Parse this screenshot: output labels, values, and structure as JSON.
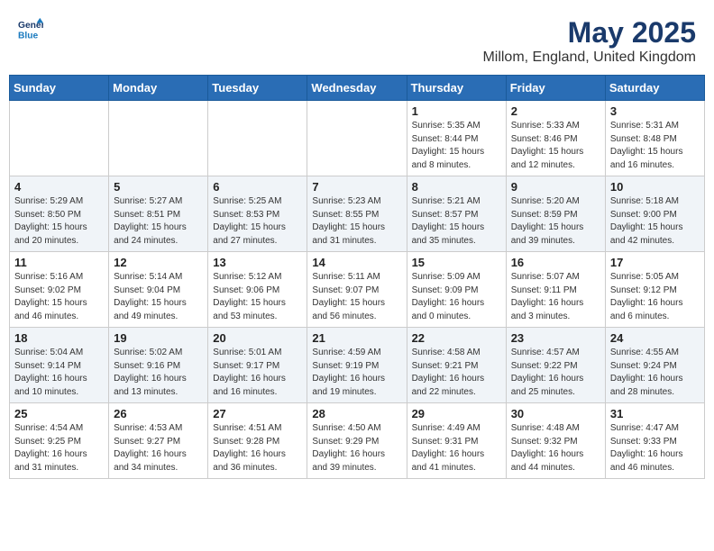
{
  "header": {
    "logo_line1": "General",
    "logo_line2": "Blue",
    "title": "May 2025",
    "subtitle": "Millom, England, United Kingdom"
  },
  "weekdays": [
    "Sunday",
    "Monday",
    "Tuesday",
    "Wednesday",
    "Thursday",
    "Friday",
    "Saturday"
  ],
  "weeks": [
    [
      {
        "day": "",
        "info": ""
      },
      {
        "day": "",
        "info": ""
      },
      {
        "day": "",
        "info": ""
      },
      {
        "day": "",
        "info": ""
      },
      {
        "day": "1",
        "info": "Sunrise: 5:35 AM\nSunset: 8:44 PM\nDaylight: 15 hours\nand 8 minutes."
      },
      {
        "day": "2",
        "info": "Sunrise: 5:33 AM\nSunset: 8:46 PM\nDaylight: 15 hours\nand 12 minutes."
      },
      {
        "day": "3",
        "info": "Sunrise: 5:31 AM\nSunset: 8:48 PM\nDaylight: 15 hours\nand 16 minutes."
      }
    ],
    [
      {
        "day": "4",
        "info": "Sunrise: 5:29 AM\nSunset: 8:50 PM\nDaylight: 15 hours\nand 20 minutes."
      },
      {
        "day": "5",
        "info": "Sunrise: 5:27 AM\nSunset: 8:51 PM\nDaylight: 15 hours\nand 24 minutes."
      },
      {
        "day": "6",
        "info": "Sunrise: 5:25 AM\nSunset: 8:53 PM\nDaylight: 15 hours\nand 27 minutes."
      },
      {
        "day": "7",
        "info": "Sunrise: 5:23 AM\nSunset: 8:55 PM\nDaylight: 15 hours\nand 31 minutes."
      },
      {
        "day": "8",
        "info": "Sunrise: 5:21 AM\nSunset: 8:57 PM\nDaylight: 15 hours\nand 35 minutes."
      },
      {
        "day": "9",
        "info": "Sunrise: 5:20 AM\nSunset: 8:59 PM\nDaylight: 15 hours\nand 39 minutes."
      },
      {
        "day": "10",
        "info": "Sunrise: 5:18 AM\nSunset: 9:00 PM\nDaylight: 15 hours\nand 42 minutes."
      }
    ],
    [
      {
        "day": "11",
        "info": "Sunrise: 5:16 AM\nSunset: 9:02 PM\nDaylight: 15 hours\nand 46 minutes."
      },
      {
        "day": "12",
        "info": "Sunrise: 5:14 AM\nSunset: 9:04 PM\nDaylight: 15 hours\nand 49 minutes."
      },
      {
        "day": "13",
        "info": "Sunrise: 5:12 AM\nSunset: 9:06 PM\nDaylight: 15 hours\nand 53 minutes."
      },
      {
        "day": "14",
        "info": "Sunrise: 5:11 AM\nSunset: 9:07 PM\nDaylight: 15 hours\nand 56 minutes."
      },
      {
        "day": "15",
        "info": "Sunrise: 5:09 AM\nSunset: 9:09 PM\nDaylight: 16 hours\nand 0 minutes."
      },
      {
        "day": "16",
        "info": "Sunrise: 5:07 AM\nSunset: 9:11 PM\nDaylight: 16 hours\nand 3 minutes."
      },
      {
        "day": "17",
        "info": "Sunrise: 5:05 AM\nSunset: 9:12 PM\nDaylight: 16 hours\nand 6 minutes."
      }
    ],
    [
      {
        "day": "18",
        "info": "Sunrise: 5:04 AM\nSunset: 9:14 PM\nDaylight: 16 hours\nand 10 minutes."
      },
      {
        "day": "19",
        "info": "Sunrise: 5:02 AM\nSunset: 9:16 PM\nDaylight: 16 hours\nand 13 minutes."
      },
      {
        "day": "20",
        "info": "Sunrise: 5:01 AM\nSunset: 9:17 PM\nDaylight: 16 hours\nand 16 minutes."
      },
      {
        "day": "21",
        "info": "Sunrise: 4:59 AM\nSunset: 9:19 PM\nDaylight: 16 hours\nand 19 minutes."
      },
      {
        "day": "22",
        "info": "Sunrise: 4:58 AM\nSunset: 9:21 PM\nDaylight: 16 hours\nand 22 minutes."
      },
      {
        "day": "23",
        "info": "Sunrise: 4:57 AM\nSunset: 9:22 PM\nDaylight: 16 hours\nand 25 minutes."
      },
      {
        "day": "24",
        "info": "Sunrise: 4:55 AM\nSunset: 9:24 PM\nDaylight: 16 hours\nand 28 minutes."
      }
    ],
    [
      {
        "day": "25",
        "info": "Sunrise: 4:54 AM\nSunset: 9:25 PM\nDaylight: 16 hours\nand 31 minutes."
      },
      {
        "day": "26",
        "info": "Sunrise: 4:53 AM\nSunset: 9:27 PM\nDaylight: 16 hours\nand 34 minutes."
      },
      {
        "day": "27",
        "info": "Sunrise: 4:51 AM\nSunset: 9:28 PM\nDaylight: 16 hours\nand 36 minutes."
      },
      {
        "day": "28",
        "info": "Sunrise: 4:50 AM\nSunset: 9:29 PM\nDaylight: 16 hours\nand 39 minutes."
      },
      {
        "day": "29",
        "info": "Sunrise: 4:49 AM\nSunset: 9:31 PM\nDaylight: 16 hours\nand 41 minutes."
      },
      {
        "day": "30",
        "info": "Sunrise: 4:48 AM\nSunset: 9:32 PM\nDaylight: 16 hours\nand 44 minutes."
      },
      {
        "day": "31",
        "info": "Sunrise: 4:47 AM\nSunset: 9:33 PM\nDaylight: 16 hours\nand 46 minutes."
      }
    ]
  ]
}
